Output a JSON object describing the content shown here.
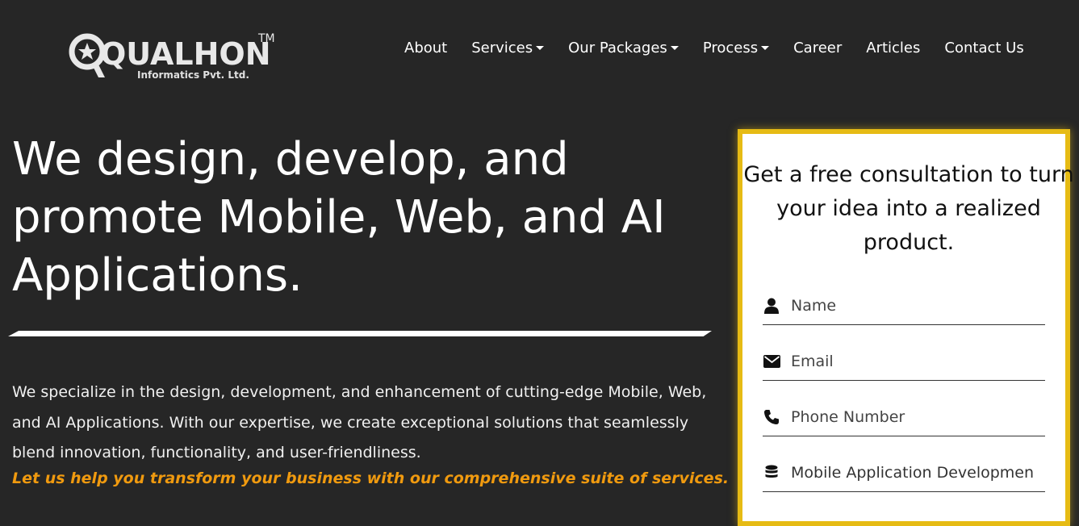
{
  "brand": {
    "name": "QUALHON",
    "trademark": "TM",
    "subtitle": "Informatics Pvt. Ltd."
  },
  "nav": {
    "items": [
      {
        "label": "About",
        "dropdown": false
      },
      {
        "label": "Services",
        "dropdown": true
      },
      {
        "label": "Our Packages",
        "dropdown": true
      },
      {
        "label": "Process",
        "dropdown": true
      },
      {
        "label": "Career",
        "dropdown": false
      },
      {
        "label": "Articles",
        "dropdown": false
      },
      {
        "label": "Contact Us",
        "dropdown": false
      }
    ]
  },
  "hero": {
    "headline": "We design, develop, and promote Mobile, Web, and AI Applications.",
    "description": "We specialize in the design, development, and enhancement of cutting-edge Mobile, Web, and AI Applications. With our expertise, we create exceptional solutions that seamlessly blend innovation, functionality, and user-friendliness.",
    "tagline": "Let us help you transform your business with our comprehensive suite of services."
  },
  "form": {
    "title": "Get a free consultation to turn your idea into a realized product.",
    "name_placeholder": "Name",
    "email_placeholder": "Email",
    "phone_placeholder": "Phone Number",
    "service_selected": "Mobile Application Development"
  },
  "colors": {
    "background": "#262626",
    "accent_border": "#e6bb14",
    "tagline": "#f09a0f"
  },
  "icons": {
    "name": "user-icon",
    "email": "envelope-icon",
    "phone": "phone-icon",
    "service": "database-icon"
  }
}
